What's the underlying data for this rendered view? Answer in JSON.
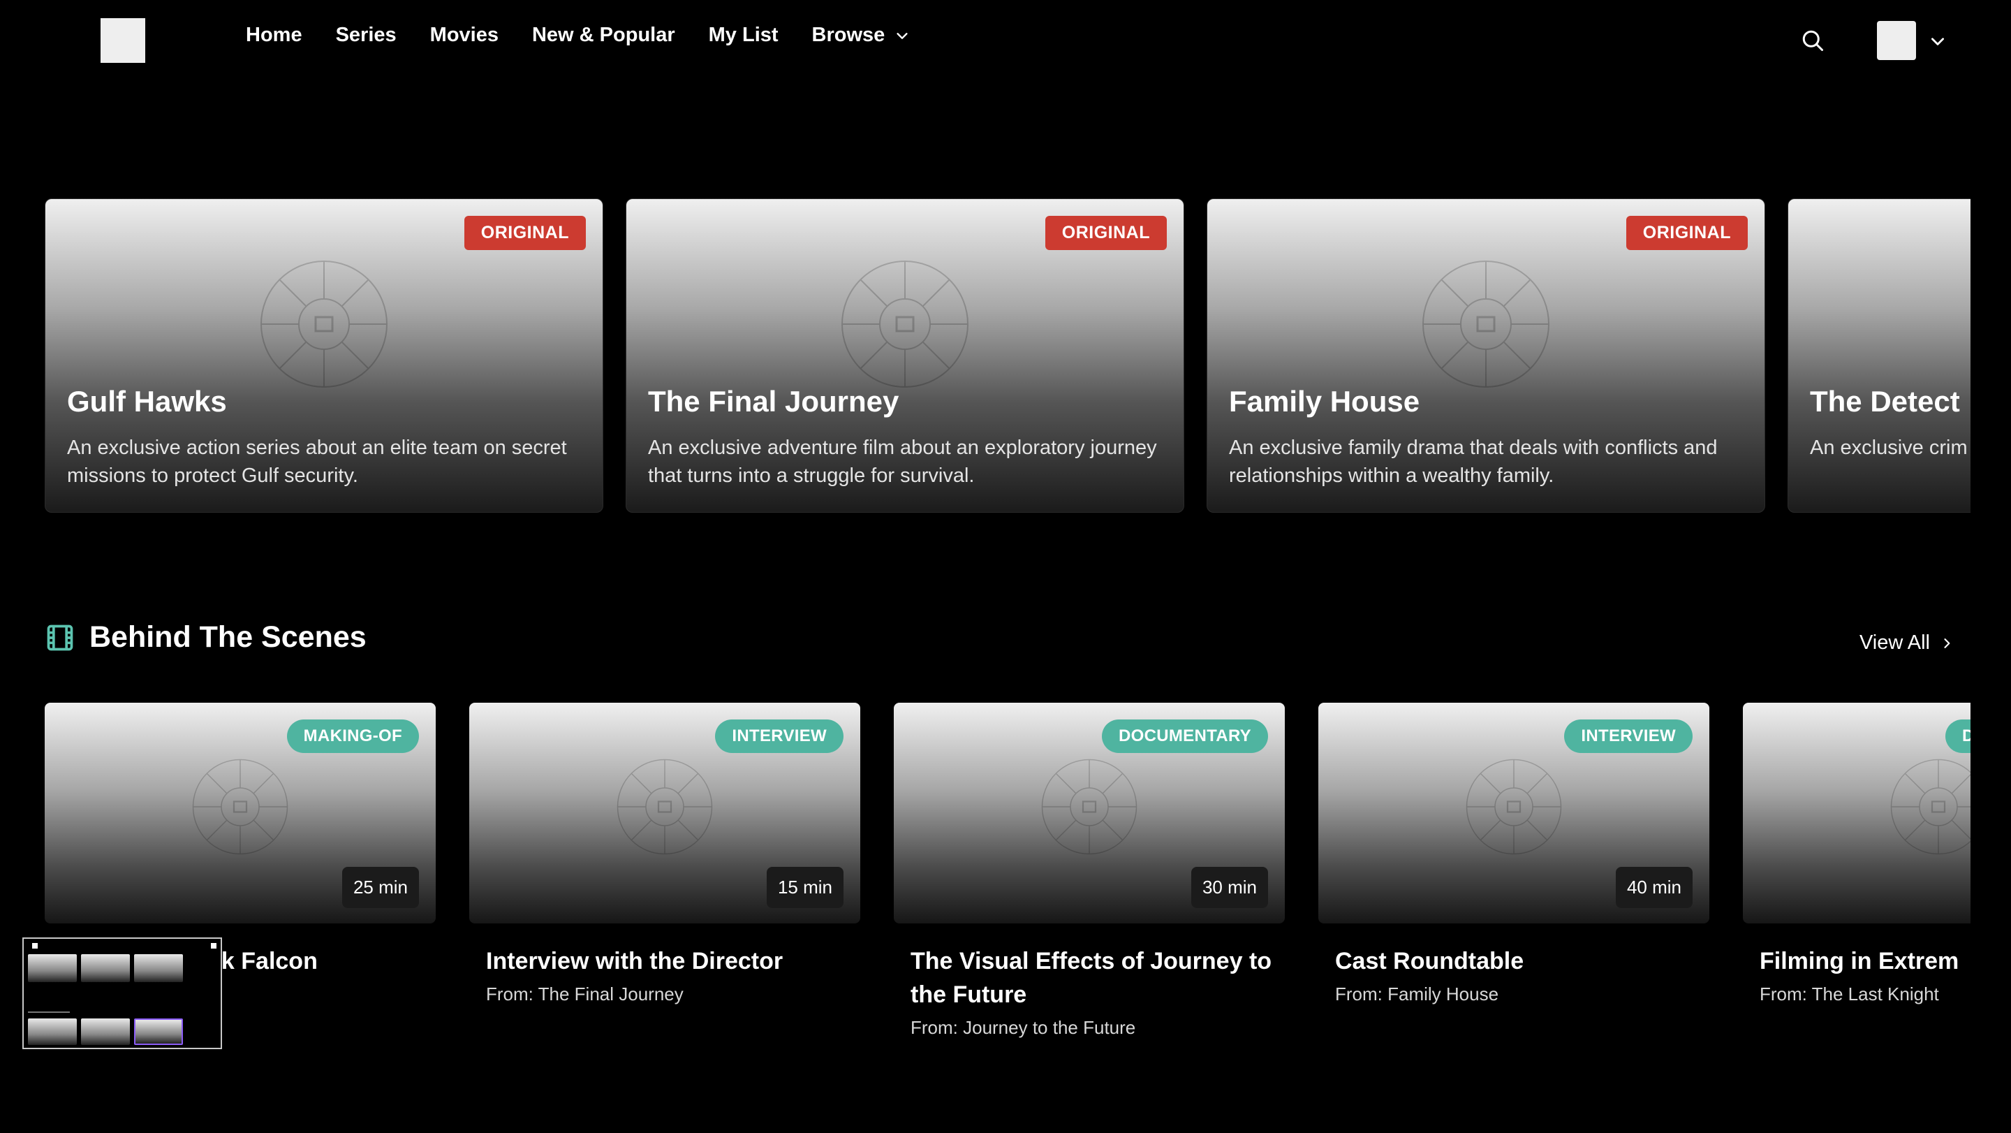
{
  "nav": {
    "items": [
      {
        "label": "Home"
      },
      {
        "label": "Series"
      },
      {
        "label": "Movies"
      },
      {
        "label": "New & Popular"
      },
      {
        "label": "My List"
      },
      {
        "label": "Browse"
      }
    ]
  },
  "originals": [
    {
      "badge": "ORIGINAL",
      "title": "Gulf Hawks",
      "description": "An exclusive action series about an elite team on secret missions to protect Gulf security."
    },
    {
      "badge": "ORIGINAL",
      "title": "The Final Journey",
      "description": "An exclusive adventure film about an exploratory journey that turns into a struggle for survival."
    },
    {
      "badge": "ORIGINAL",
      "title": "Family House",
      "description": "An exclusive family drama that deals with conflicts and relationships within a wealthy family."
    },
    {
      "badge": "",
      "title": "The Detect",
      "description": "An exclusive crim solved by a brillia"
    }
  ],
  "behind_the_scenes": {
    "title": "Behind The Scenes",
    "view_all": "View All",
    "items": [
      {
        "badge": "MAKING-OF",
        "duration": "25 min",
        "title": "ck Falcon",
        "from": ""
      },
      {
        "badge": "INTERVIEW",
        "duration": "15 min",
        "title": "Interview with the Director",
        "from": "From: The Final Journey"
      },
      {
        "badge": "DOCUMENTARY",
        "duration": "30 min",
        "title": "The Visual Effects of Journey to the Future",
        "from": "From: Journey to the Future"
      },
      {
        "badge": "INTERVIEW",
        "duration": "40 min",
        "title": "Cast Roundtable",
        "from": "From: Family House"
      },
      {
        "badge": "D",
        "duration": "",
        "title": "Filming in Extrem",
        "from": "From: The Last Knight"
      }
    ]
  },
  "colors": {
    "background": "#000000",
    "original_badge": "#cc3b30",
    "bts_badge": "#4fb4a0",
    "section_icon": "#5cc4b0"
  },
  "icons": {
    "search": "search-icon",
    "browse_chevron": "chevron-down-icon",
    "section": "film-icon",
    "view_all_chevron": "chevron-right-icon"
  }
}
